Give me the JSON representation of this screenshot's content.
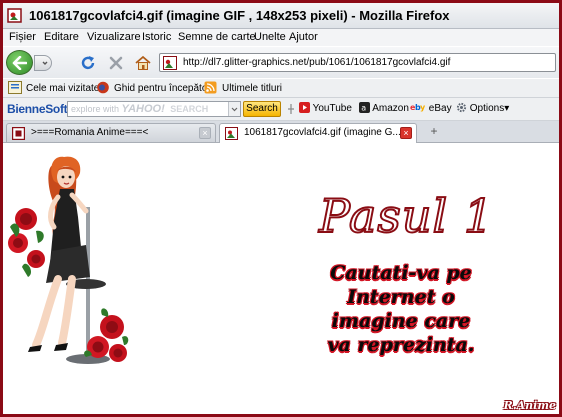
{
  "window": {
    "title": "1061817gcovlafci4.gif (imagine GIF , 148x253 pixeli) - Mozilla Firefox"
  },
  "menu": {
    "items": [
      {
        "label": "Fișier"
      },
      {
        "label": "Editare"
      },
      {
        "label": "Vizualizare"
      },
      {
        "label": "Istoric"
      },
      {
        "label": "Semne de carte"
      },
      {
        "label": "Unelte"
      },
      {
        "label": "Ajutor"
      }
    ]
  },
  "navigation": {
    "url": "http://dl7.glitter-graphics.net/pub/1061/1061817gcovlafci4.gif"
  },
  "bookmarks": [
    {
      "label": "Cele mai vizitate",
      "icon": "bookmark-star-icon"
    },
    {
      "label": "Ghid pentru începători",
      "icon": "firefox-icon"
    },
    {
      "label": "Ultimele titluri",
      "icon": "rss-icon"
    }
  ],
  "toolbar": {
    "brand": "BienneSoft",
    "search_placeholder_prefix": "explore with",
    "search_placeholder_logo": "YAHOO!",
    "search_placeholder_suffix": "SEARCH",
    "search_button": "Search",
    "links": [
      {
        "label": "YouTube",
        "icon": "youtube-icon"
      },
      {
        "label": "Amazon",
        "icon": "amazon-icon"
      },
      {
        "label": "eBay",
        "icon": "ebay-icon"
      },
      {
        "label": "Options",
        "icon": "gear-icon"
      }
    ]
  },
  "tabs": [
    {
      "label": ">===Romania Anime===<",
      "active": false
    },
    {
      "label": "1061817gcovlafci4.gif (imagine G...",
      "active": true
    }
  ],
  "content": {
    "heading": "Pasul 1",
    "body_lines": [
      "Cautati-va pe",
      "Internet o",
      "imagine care",
      "va reprezinta."
    ],
    "signature": "R.Anime"
  },
  "colors": {
    "frame_border": "#8b0a16",
    "heading_stroke": "#8a0d14",
    "text_outline": "#d21524"
  }
}
